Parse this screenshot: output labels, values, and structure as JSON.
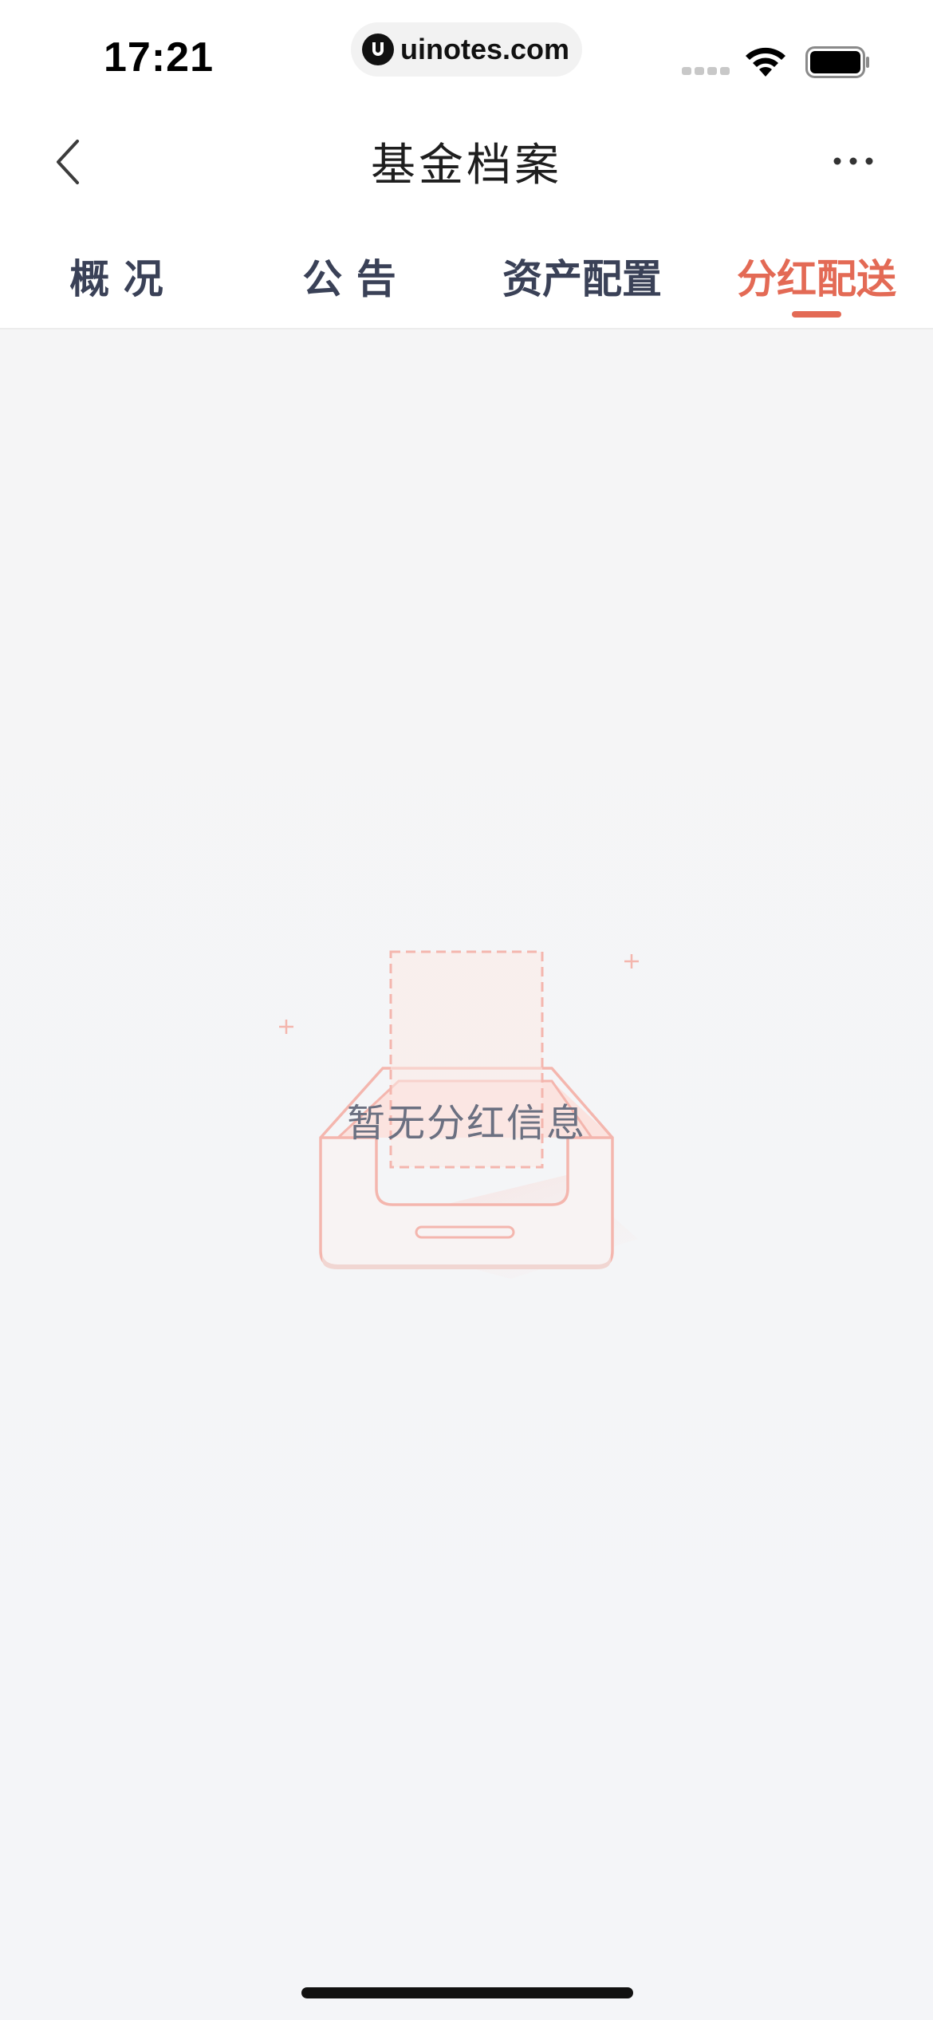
{
  "status_bar": {
    "time": "17:21",
    "url": "uinotes.com"
  },
  "nav": {
    "title": "基金档案",
    "back_icon": "chevron-left-icon",
    "more_icon": "more-horizontal-icon"
  },
  "tabs": [
    {
      "label": "概 况",
      "active": false
    },
    {
      "label": "公 告",
      "active": false
    },
    {
      "label": "资产配置",
      "active": false
    },
    {
      "label": "分红配送",
      "active": true
    }
  ],
  "empty_state": {
    "message": "暂无分红信息",
    "icon": "empty-inbox-icon"
  },
  "colors": {
    "accent": "#e36a55",
    "tab_text": "#3a4157",
    "empty_text": "#6b7081",
    "illustration": "#f4b6ae"
  }
}
